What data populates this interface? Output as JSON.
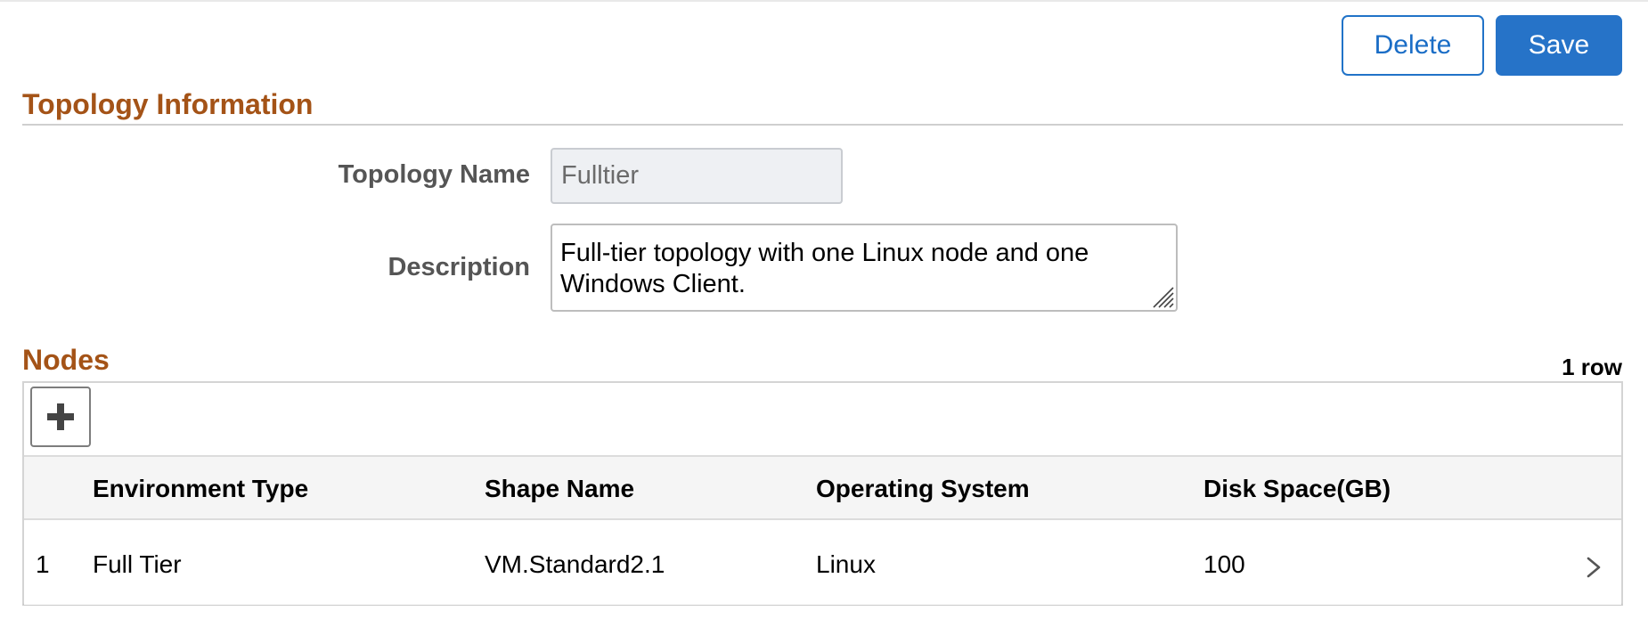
{
  "toolbar": {
    "delete_label": "Delete",
    "save_label": "Save"
  },
  "topology_section": {
    "title": "Topology Information",
    "name_label": "Topology Name",
    "name_value": "Fulltier",
    "description_label": "Description",
    "description_value": "Full-tier topology with one Linux node and one Windows Client."
  },
  "nodes_section": {
    "title": "Nodes",
    "row_count": "1 row",
    "add_icon": "plus-icon",
    "columns": [
      "Environment Type",
      "Shape Name",
      "Operating System",
      "Disk Space(GB)"
    ],
    "rows": [
      {
        "index": "1",
        "environment_type": "Full Tier",
        "shape_name": "VM.Standard2.1",
        "operating_system": "Linux",
        "disk_space": "100",
        "action_icon": "chevron-right-icon"
      }
    ]
  },
  "colors": {
    "section_title": "#a45317",
    "primary_button": "#2673c8",
    "secondary_button_text": "#1a6dc6",
    "header_background": "#f5f5f5"
  }
}
